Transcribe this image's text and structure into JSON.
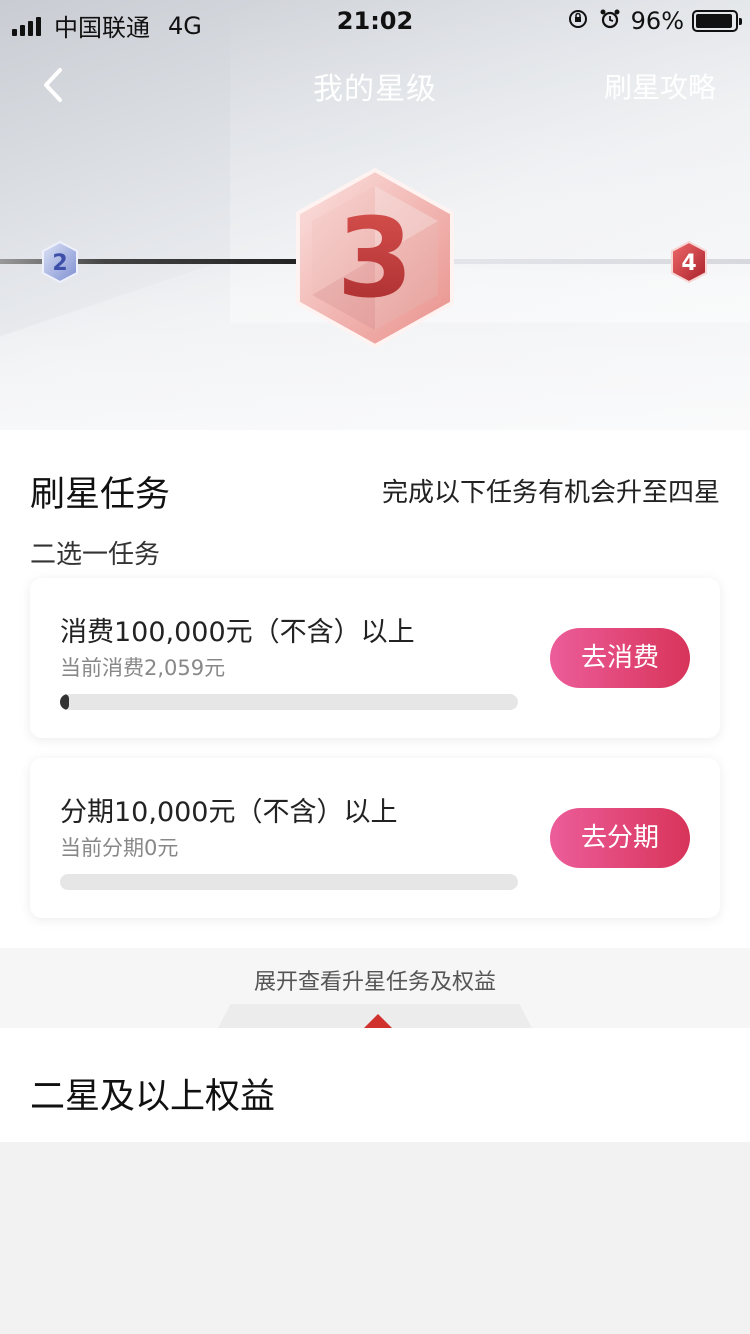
{
  "status_bar": {
    "carrier": "中国联通",
    "network": "4G",
    "time": "21:02",
    "battery_percent": "96%",
    "icons": [
      "signal-icon",
      "orientation-lock-icon",
      "alarm-icon",
      "battery-icon"
    ]
  },
  "nav": {
    "title": "我的星级",
    "right_action": "刷星攻略"
  },
  "levels": {
    "previous": "2",
    "current": "3",
    "next": "4"
  },
  "tasks": {
    "title": "刷星任务",
    "hint": "完成以下任务有机会升至四星",
    "subtitle": "二选一任务",
    "items": [
      {
        "name": "消费100,000元（不含）以上",
        "current": "当前消费2,059元",
        "progress": 0.02,
        "button": "去消费"
      },
      {
        "name": "分期10,000元（不含）以上",
        "current": "当前分期0元",
        "progress": 0,
        "button": "去分期"
      }
    ]
  },
  "expand": {
    "label": "展开查看升星任务及权益"
  },
  "benefits": {
    "title": "二星及以上权益"
  },
  "colors": {
    "accent_button_start": "#ec5d9a",
    "accent_button_end": "#d8345a",
    "badge_red": "#c9323e",
    "arrow_red": "#d0312d"
  }
}
